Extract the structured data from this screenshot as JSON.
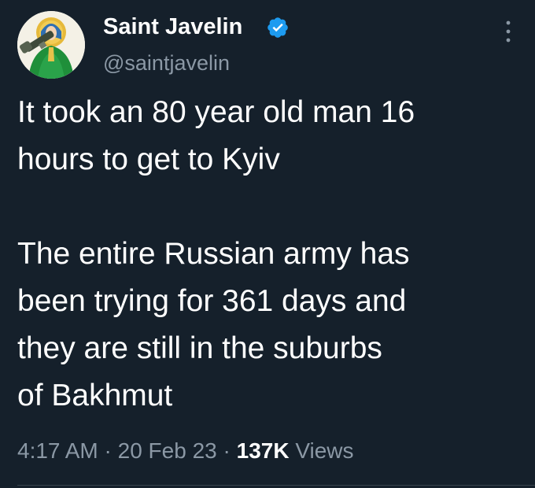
{
  "author": {
    "display_name": "Saint Javelin",
    "handle": "@saintjavelin",
    "avatar_icon": "saint-javelin-avatar-icon",
    "verified_icon": "verified-badge-icon",
    "verified_color": "#1d9bf0"
  },
  "menu": {
    "icon": "more-vertical-icon"
  },
  "tweet": {
    "paragraphs": [
      [
        "It took an 80 year old man 16",
        "hours to get to Kyiv"
      ],
      [
        "The entire Russian army has",
        "been trying for 361 days and",
        "they are still in the suburbs",
        "of Bakhmut"
      ]
    ]
  },
  "meta": {
    "time": "4:17 AM",
    "separator": "·",
    "date": "20 Feb 23",
    "views_count": "137K",
    "views_label": "Views"
  },
  "colors": {
    "background": "#15202b",
    "text": "#ffffff",
    "secondary": "#8b98a5",
    "divider": "#38444d"
  }
}
